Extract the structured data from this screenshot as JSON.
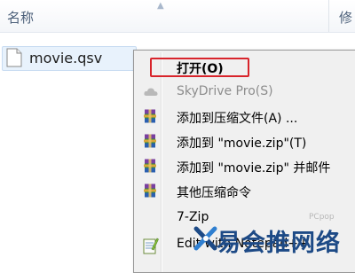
{
  "header": {
    "name_column": "名称",
    "modified_column": "修"
  },
  "file": {
    "name": "movie.qsv",
    "icon": "document-icon"
  },
  "context_menu": {
    "items": [
      {
        "label": "打开(O)",
        "icon": "",
        "bold": true,
        "disabled": false
      },
      {
        "label": "SkyDrive Pro(S)",
        "icon": "skydrive-cloud-icon",
        "bold": false,
        "disabled": true
      },
      {
        "label": "添加到压缩文件(A) ...",
        "icon": "winrar-icon",
        "bold": false,
        "disabled": false
      },
      {
        "label": "添加到 \"movie.zip\"(T)",
        "icon": "winrar-icon",
        "bold": false,
        "disabled": false
      },
      {
        "label": "添加到 \"movie.zip\" 并邮件",
        "icon": "winrar-icon",
        "bold": false,
        "disabled": false
      },
      {
        "label": "其他压缩命令",
        "icon": "winrar-icon",
        "bold": false,
        "disabled": false
      },
      {
        "label": "7-Zip",
        "icon": "",
        "bold": false,
        "disabled": false
      },
      {
        "label": "Edit with Notepad++",
        "icon": "notepad-plus-plus-icon",
        "bold": false,
        "disabled": false
      }
    ]
  },
  "watermark": {
    "text": "易会推网络",
    "small_text": "PCpop"
  },
  "colors": {
    "highlight_border": "#d8242b",
    "selection_bg": "#e8f2fc",
    "watermark": "#1d4a86"
  }
}
